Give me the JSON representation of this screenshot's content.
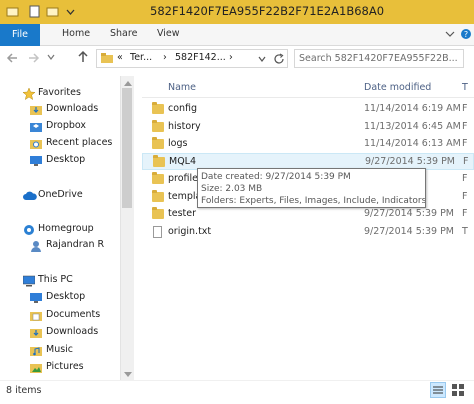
{
  "window": {
    "title": "582F1420F7EA955F22B2F71E2A1B68A0"
  },
  "ribbon": {
    "tabs": [
      "File",
      "Home",
      "Share",
      "View"
    ]
  },
  "address": {
    "crumbs": [
      "«",
      "Ter...",
      "›",
      "582F142...",
      "›"
    ],
    "search_placeholder": "Search 582F1420F7EA955F22B..."
  },
  "nav_pane": {
    "favorites": {
      "label": "Favorites",
      "items": [
        "Downloads",
        "Dropbox",
        "Recent places",
        "Desktop"
      ]
    },
    "onedrive": "OneDrive",
    "homegroup": {
      "label": "Homegroup",
      "items": [
        "Rajandran R"
      ]
    },
    "thispc": {
      "label": "This PC",
      "items": [
        "Desktop",
        "Documents",
        "Downloads",
        "Music",
        "Pictures"
      ]
    }
  },
  "columns": {
    "name": "Name",
    "date": "Date modified",
    "type": "T"
  },
  "files": [
    {
      "name": "config",
      "date": "11/14/2014 6:19 AM",
      "type": "F",
      "kind": "folder"
    },
    {
      "name": "history",
      "date": "11/13/2014 6:45 AM",
      "type": "F",
      "kind": "folder"
    },
    {
      "name": "logs",
      "date": "11/14/2014 6:13 AM",
      "type": "F",
      "kind": "folder"
    },
    {
      "name": "MQL4",
      "date": "9/27/2014 5:39 PM",
      "type": "F",
      "kind": "folder"
    },
    {
      "name": "profile",
      "date": "",
      "type": "F",
      "kind": "folder"
    },
    {
      "name": "templa",
      "date": "",
      "type": "F",
      "kind": "folder"
    },
    {
      "name": "tester",
      "date": "9/27/2014 5:39 PM",
      "type": "F",
      "kind": "folder"
    },
    {
      "name": "origin.txt",
      "date": "9/27/2014 5:39 PM",
      "type": "T",
      "kind": "file"
    }
  ],
  "tooltip": {
    "line1": "Date created: 9/27/2014 5:39 PM",
    "line2": "Size: 2.03 MB",
    "line3": "Folders: Experts, Files, Images, Include, Indicators, ..."
  },
  "status": {
    "count": "8 items"
  },
  "colors": {
    "titlebar": "#e8bf3a",
    "file_tab": "#1979ca",
    "folder": "#e9c354"
  }
}
